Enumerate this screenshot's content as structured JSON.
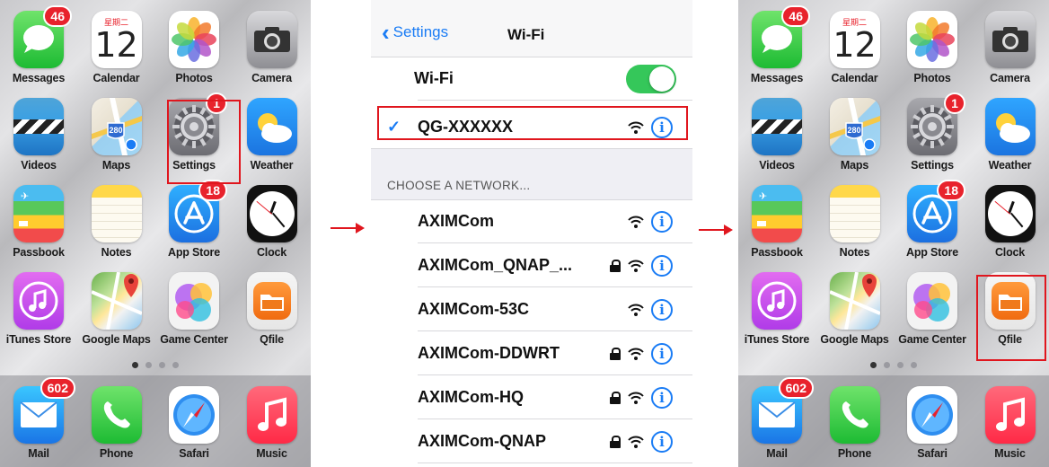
{
  "colors": {
    "highlight_red": "#e0161e",
    "ios_blue": "#1a7cf5",
    "toggle_green": "#35c75a",
    "badge_red": "#e8222c"
  },
  "home_left": {
    "apps": [
      {
        "label": "Messages",
        "badge": "46",
        "icon": "messages-icon"
      },
      {
        "label": "Calendar",
        "icon": "calendar-icon",
        "day": "星期二",
        "date": "12"
      },
      {
        "label": "Photos",
        "icon": "photos-icon"
      },
      {
        "label": "Camera",
        "icon": "camera-icon"
      },
      {
        "label": "Videos",
        "icon": "videos-icon"
      },
      {
        "label": "Maps",
        "icon": "maps-icon",
        "shield": "280"
      },
      {
        "label": "Settings",
        "badge": "1",
        "icon": "settings-icon"
      },
      {
        "label": "Weather",
        "icon": "weather-icon"
      },
      {
        "label": "Passbook",
        "icon": "passbook-icon"
      },
      {
        "label": "Notes",
        "icon": "notes-icon"
      },
      {
        "label": "App Store",
        "badge": "18",
        "icon": "app-store-icon"
      },
      {
        "label": "Clock",
        "icon": "clock-icon"
      },
      {
        "label": "iTunes Store",
        "icon": "itunes-store-icon"
      },
      {
        "label": "Google Maps",
        "icon": "google-maps-icon"
      },
      {
        "label": "Game Center",
        "icon": "game-center-icon"
      },
      {
        "label": "Qfile",
        "icon": "qfile-icon"
      }
    ],
    "dock": [
      {
        "label": "Mail",
        "badge": "602",
        "icon": "mail-icon"
      },
      {
        "label": "Phone",
        "icon": "phone-icon"
      },
      {
        "label": "Safari",
        "icon": "safari-icon"
      },
      {
        "label": "Music",
        "icon": "music-icon"
      }
    ]
  },
  "wifi": {
    "back_label": "Settings",
    "title": "Wi-Fi",
    "toggle_label": "Wi-Fi",
    "toggle_on": true,
    "connected_network": "QG-XXXXXX",
    "section_header": "CHOOSE A NETWORK...",
    "networks": [
      {
        "name": "AXIMCom",
        "locked": false
      },
      {
        "name": "AXIMCom_QNAP_...",
        "locked": true
      },
      {
        "name": "AXIMCom-53C",
        "locked": false
      },
      {
        "name": "AXIMCom-DDWRT",
        "locked": true
      },
      {
        "name": "AXIMCom-HQ",
        "locked": true
      },
      {
        "name": "AXIMCom-QNAP",
        "locked": true
      }
    ]
  }
}
